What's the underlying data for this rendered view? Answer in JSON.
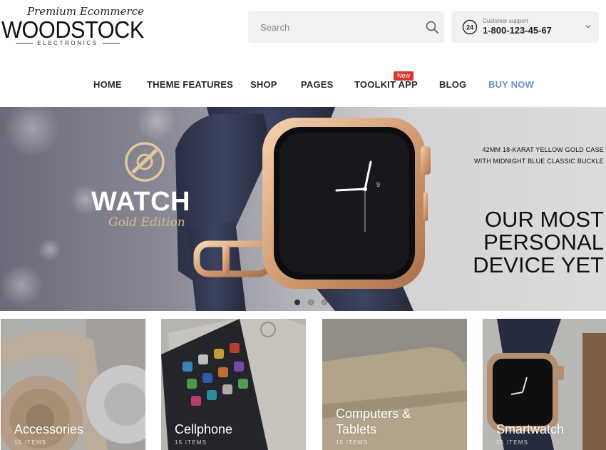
{
  "brand": {
    "tagline": "Premium Ecommerce",
    "name": "WOODSTOCK",
    "sub": "ELECTRONICS"
  },
  "search": {
    "placeholder": "Search",
    "icon": "search-icon"
  },
  "support": {
    "label": "Customer support",
    "phone": "1-800-123-45-67",
    "icon": "24h-support-icon",
    "badge_text": "24"
  },
  "nav": {
    "items": [
      {
        "label": "HOME"
      },
      {
        "label": "THEME FEATURES"
      },
      {
        "label": "SHOP"
      },
      {
        "label": "PAGES"
      },
      {
        "label": "TOOLKIT APP",
        "badge": "New"
      },
      {
        "label": "BLOG"
      },
      {
        "label": "BUY NOW"
      }
    ],
    "accent_color": "#6e8fc9",
    "badge_color": "#d63a2c"
  },
  "hero": {
    "brand": "WATCH",
    "edition": "Gold Edition",
    "caption_line1": "42MM 18-KARAT YELLOW GOLD CASE",
    "caption_line2": "WITH MIDNIGHT BLUE CLASSIC BUCKLE",
    "headline_line1": "OUR MOST",
    "headline_line2": "PERSONAL",
    "headline_line3": "DEVICE YET",
    "slides": 3,
    "active_slide": 1
  },
  "categories": [
    {
      "name_line1": "Accessories",
      "name_line2": "",
      "count": "15 ITEMS"
    },
    {
      "name_line1": "Cellphone",
      "name_line2": "",
      "count": "15 ITEMS"
    },
    {
      "name_line1": "Computers &",
      "name_line2": "Tablets",
      "count": "15 ITEMS"
    },
    {
      "name_line1": "Smartwatch",
      "name_line2": "",
      "count": "15 ITEMS"
    }
  ]
}
